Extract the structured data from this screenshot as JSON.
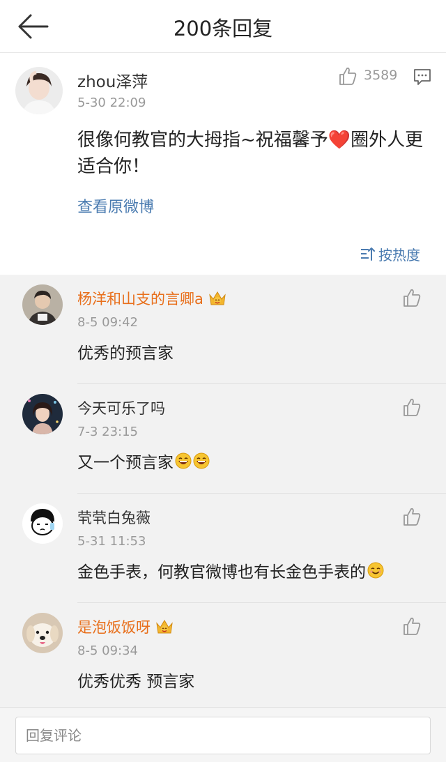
{
  "header": {
    "title": "200条回复"
  },
  "main_comment": {
    "user_name": "zhou泽萍",
    "time": "5-30 22:09",
    "like_count": "3589",
    "text_before_heart": "很像何教官的大拇指~祝福馨予",
    "heart": "❤️",
    "text_after_heart": "圈外人更适合你！",
    "view_original": "查看原微博",
    "sort_label": "按热度"
  },
  "replies": [
    {
      "user_name": "杨洋和山支的言卿a",
      "vip": true,
      "time": "8-5 09:42",
      "text": "优秀的预言家",
      "emoji_count": 0,
      "emoji": "none"
    },
    {
      "user_name": "今天可乐了吗",
      "vip": false,
      "time": "7-3 23:15",
      "text": "又一个预言家",
      "emoji_count": 2,
      "emoji": "laughing-face"
    },
    {
      "user_name": "茕茕白兔薇",
      "vip": false,
      "time": "5-31 11:53",
      "text": "金色手表，何教官微博也有长金色手表的",
      "emoji_count": 1,
      "emoji": "smiling-face"
    },
    {
      "user_name": "是泡饭饭呀",
      "vip": true,
      "time": "8-5 09:34",
      "text": "优秀优秀 预言家",
      "emoji_count": 0,
      "emoji": "none"
    }
  ],
  "footer": {
    "reply_placeholder": "回复评论"
  },
  "colors": {
    "link_blue": "#4a7bb0",
    "vip_orange": "#e86f1b",
    "heart_red": "#e0243a",
    "reply_bg": "#f2f2f2"
  }
}
